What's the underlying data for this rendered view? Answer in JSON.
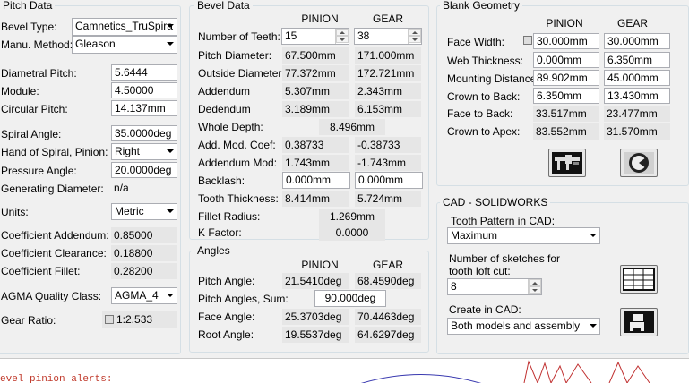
{
  "pitch_data": {
    "title": "Pitch Data",
    "bevel_type": {
      "label": "Bevel Type:",
      "value": "Camnetics_TruSpira"
    },
    "manu_method": {
      "label": "Manu. Method:",
      "value": "Gleason"
    },
    "diametral_pitch": {
      "label": "Diametral Pitch:",
      "value": "5.6444"
    },
    "module": {
      "label": "Module:",
      "value": "4.50000"
    },
    "circular_pitch": {
      "label": "Circular Pitch:",
      "value": "14.137mm"
    },
    "spiral_angle": {
      "label": "Spiral Angle:",
      "value": "35.0000deg"
    },
    "hand_of_spiral": {
      "label": "Hand of Spiral, Pinion:",
      "value": "Right"
    },
    "pressure_angle": {
      "label": "Pressure Angle:",
      "value": "20.0000deg"
    },
    "generating_diameter": {
      "label": "Generating Diameter:",
      "value": "n/a"
    },
    "units": {
      "label": "Units:",
      "value": "Metric"
    },
    "coef_addendum": {
      "label": "Coefficient Addendum:",
      "value": "0.85000"
    },
    "coef_clearance": {
      "label": "Coefficient Clearance:",
      "value": "0.18800"
    },
    "coef_fillet": {
      "label": "Coefficient Fillet:",
      "value": "0.28200"
    },
    "agma_class": {
      "label": "AGMA Quality Class:",
      "value": "AGMA_4"
    },
    "gear_ratio": {
      "label": "Gear Ratio:",
      "value": "1:2.533"
    }
  },
  "bevel_data": {
    "title": "Bevel Data",
    "col_pinion": "PINION",
    "col_gear": "GEAR",
    "rows": [
      {
        "label": "Number of Teeth:",
        "pinion": "15",
        "gear": "38"
      },
      {
        "label": "Pitch Diameter:",
        "pinion": "67.500mm",
        "gear": "171.000mm"
      },
      {
        "label": "Outside Diameter:",
        "pinion": "77.372mm",
        "gear": "172.721mm"
      },
      {
        "label": "Addendum",
        "pinion": "5.307mm",
        "gear": "2.343mm"
      },
      {
        "label": "Dedendum",
        "pinion": "3.189mm",
        "gear": "6.153mm"
      }
    ],
    "whole_depth": {
      "label": "Whole Depth:",
      "value": "8.496mm"
    },
    "rows2": [
      {
        "label": "Add. Mod. Coef:",
        "pinion": "0.38733",
        "gear": "-0.38733"
      },
      {
        "label": "Addendum Mod:",
        "pinion": "1.743mm",
        "gear": "-1.743mm"
      },
      {
        "label": "Backlash:",
        "pinion": "0.000mm",
        "gear": "0.000mm"
      },
      {
        "label": "Tooth Thickness:",
        "pinion": "8.414mm",
        "gear": "5.724mm"
      }
    ],
    "fillet_radius": {
      "label": "Fillet Radius:",
      "value": "1.269mm"
    },
    "k_factor": {
      "label": "K Factor:",
      "value": "0.0000"
    }
  },
  "angles": {
    "title": "Angles",
    "col_pinion": "PINION",
    "col_gear": "GEAR",
    "pitch_angle": {
      "label": "Pitch Angle:",
      "pinion": "21.5410deg",
      "gear": "68.4590deg"
    },
    "pitch_angles_sum": {
      "label": "Pitch Angles, Sum:",
      "value": "90.000deg"
    },
    "face_angle": {
      "label": "Face Angle:",
      "pinion": "25.3703deg",
      "gear": "70.4463deg"
    },
    "root_angle": {
      "label": "Root Angle:",
      "pinion": "19.5537deg",
      "gear": "64.6297deg"
    }
  },
  "blank_geometry": {
    "title": "Blank Geometry",
    "col_pinion": "PINION",
    "col_gear": "GEAR",
    "rows": [
      {
        "label": "Face Width:",
        "pinion": "30.000mm",
        "gear": "30.000mm"
      },
      {
        "label": "Web Thickness:",
        "pinion": "0.000mm",
        "gear": "6.350mm"
      },
      {
        "label": "Mounting Distance:",
        "pinion": "89.902mm",
        "gear": "45.000mm"
      },
      {
        "label": "Crown to Back:",
        "pinion": "6.350mm",
        "gear": "13.430mm"
      },
      {
        "label": "Face to Back:",
        "pinion": "33.517mm",
        "gear": "23.477mm"
      },
      {
        "label": "Crown to Apex:",
        "pinion": "83.552mm",
        "gear": "31.570mm"
      }
    ]
  },
  "cad": {
    "title": "CAD - SOLIDWORKS",
    "tooth_pattern": {
      "label": "Tooth Pattern in CAD:",
      "value": "Maximum"
    },
    "sketches": {
      "label1": "Number of sketches for",
      "label2": "tooth loft cut:",
      "value": "8"
    },
    "create_in": {
      "label": "Create in CAD:",
      "value": "Both models and assembly"
    }
  },
  "bottom_alert": "evel pinion alerts:",
  "colors": {
    "alert": "#c0392b",
    "groupbox_border": "#d5dfe5"
  }
}
